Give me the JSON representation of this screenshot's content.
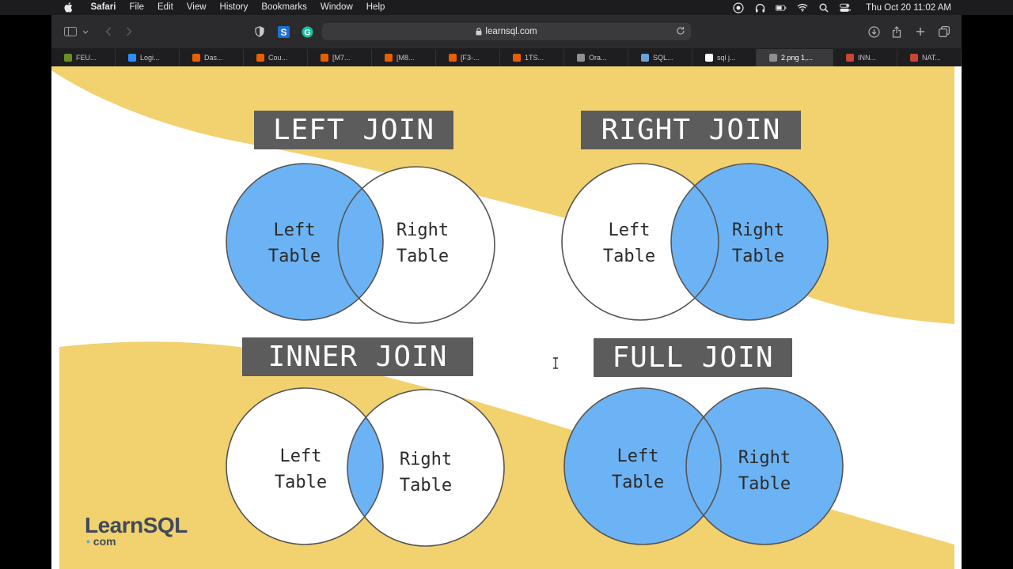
{
  "menubar": {
    "items": [
      "Safari",
      "File",
      "Edit",
      "View",
      "History",
      "Bookmarks",
      "Window",
      "Help"
    ],
    "clock": "Thu Oct 20  11:02 AM"
  },
  "toolbar": {
    "url": "learnsql.com"
  },
  "tabs": [
    {
      "label": "FEU...",
      "icon": "shield-favicon",
      "color": "#6b8e23"
    },
    {
      "label": "Logi...",
      "icon": "zoom-favicon",
      "color": "#2d8cff"
    },
    {
      "label": "Das...",
      "icon": "canvas-favicon",
      "color": "#e66000"
    },
    {
      "label": "Cou...",
      "icon": "canvas-favicon",
      "color": "#e66000"
    },
    {
      "label": "[M7...",
      "icon": "canvas-favicon",
      "color": "#e66000"
    },
    {
      "label": "[M8...",
      "icon": "canvas-favicon",
      "color": "#e66000"
    },
    {
      "label": "[F3-...",
      "icon": "canvas-favicon",
      "color": "#e66000"
    },
    {
      "label": "1TS...",
      "icon": "canvas-favicon",
      "color": "#e66000"
    },
    {
      "label": "Ora...",
      "icon": "oracle-favicon",
      "color": "#8e8e93"
    },
    {
      "label": "SQL...",
      "icon": "sql-favicon",
      "color": "#6aa3d6"
    },
    {
      "label": "sql j...",
      "icon": "google-favicon",
      "color": "#ffffff"
    },
    {
      "label": "2.png 1,...",
      "icon": "image-favicon",
      "color": "#8e8e93",
      "active": true
    },
    {
      "label": "INN...",
      "icon": "oracle-red-favicon",
      "color": "#c74634"
    },
    {
      "label": "NAT...",
      "icon": "oracle-red-favicon",
      "color": "#c74634"
    }
  ],
  "diagram": {
    "colors": {
      "fill": "#6cb3f5",
      "yellow": "#f2d16f",
      "title_bg": "#5c5c5c"
    },
    "joins": [
      {
        "title": "LEFT JOIN",
        "left_label": [
          "Left",
          "Table"
        ],
        "right_label": [
          "Right",
          "Table"
        ]
      },
      {
        "title": "RIGHT JOIN",
        "left_label": [
          "Left",
          "Table"
        ],
        "right_label": [
          "Right",
          "Table"
        ]
      },
      {
        "title": "INNER JOIN",
        "left_label": [
          "Left",
          "Table"
        ],
        "right_label": [
          "Right",
          "Table"
        ]
      },
      {
        "title": "FULL JOIN",
        "left_label": [
          "Left",
          "Table"
        ],
        "right_label": [
          "Right",
          "Table"
        ]
      }
    ]
  },
  "logo": {
    "main_a": "Learn",
    "main_b": "SQL",
    "sub": "com",
    "dot": "•"
  }
}
